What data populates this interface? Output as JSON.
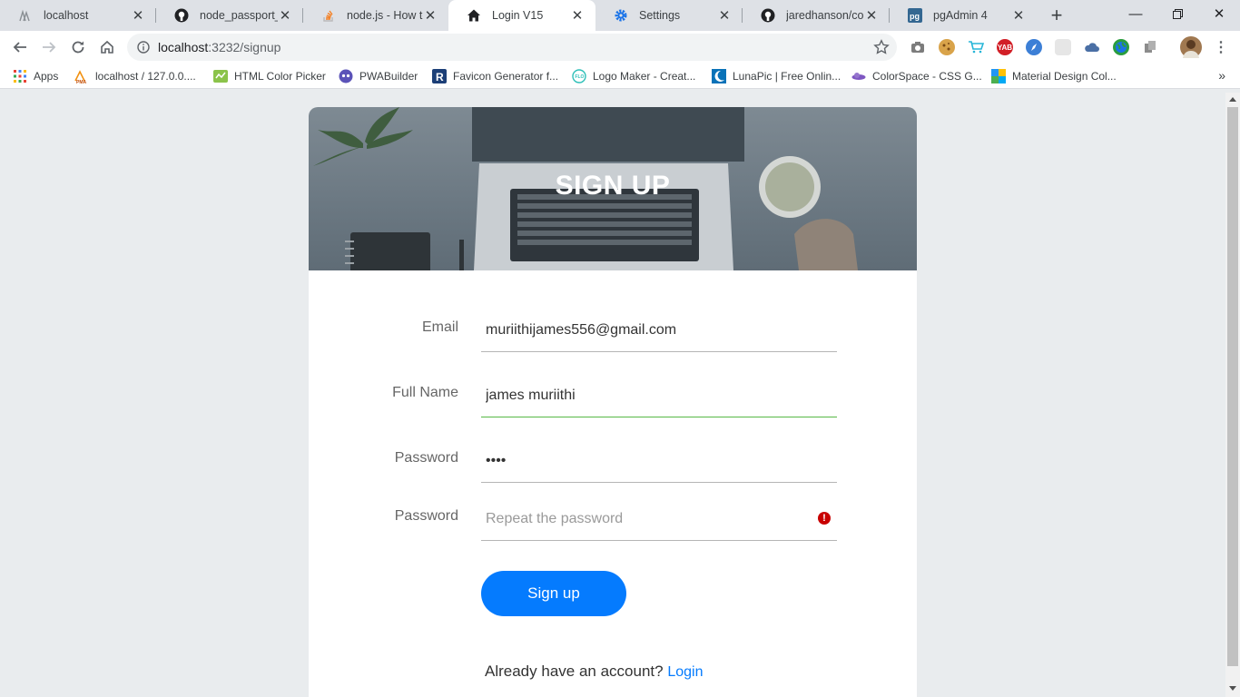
{
  "tabs": [
    {
      "title": "localhost",
      "icon": "phpmyadmin-icon"
    },
    {
      "title": "node_passport_log",
      "icon": "github-icon"
    },
    {
      "title": "node.js - How to c",
      "icon": "stackoverflow-icon"
    },
    {
      "title": "Login V15",
      "icon": "home-icon",
      "active": true
    },
    {
      "title": "Settings",
      "icon": "gear-icon"
    },
    {
      "title": "jaredhanson/conn",
      "icon": "github-icon"
    },
    {
      "title": "pgAdmin 4",
      "icon": "pgadmin-icon"
    }
  ],
  "omnibox": {
    "host": "localhost",
    "path": ":3232/signup"
  },
  "bookmarks": [
    {
      "label": "Apps"
    },
    {
      "label": "localhost / 127.0.0...."
    },
    {
      "label": "HTML Color Picker"
    },
    {
      "label": "PWABuilder"
    },
    {
      "label": "Favicon Generator f..."
    },
    {
      "label": "Logo Maker - Creat..."
    },
    {
      "label": "LunaPic | Free Onlin..."
    },
    {
      "label": "ColorSpace - CSS G..."
    },
    {
      "label": "Material Design Col..."
    }
  ],
  "form": {
    "heading": "SIGN UP",
    "email": {
      "label": "Email",
      "value": "muriithijames556@gmail.com"
    },
    "fullname": {
      "label": "Full Name",
      "value": "james muriithi"
    },
    "password": {
      "label": "Password",
      "value": "••••"
    },
    "repeat": {
      "label": "Password",
      "placeholder": "Repeat the password"
    },
    "submit_label": "Sign up",
    "footer_text": "Already have an account?",
    "login_link": "Login"
  },
  "colors": {
    "accent": "#057bfe",
    "focus_underline": "#57b846",
    "error": "#c80000"
  }
}
